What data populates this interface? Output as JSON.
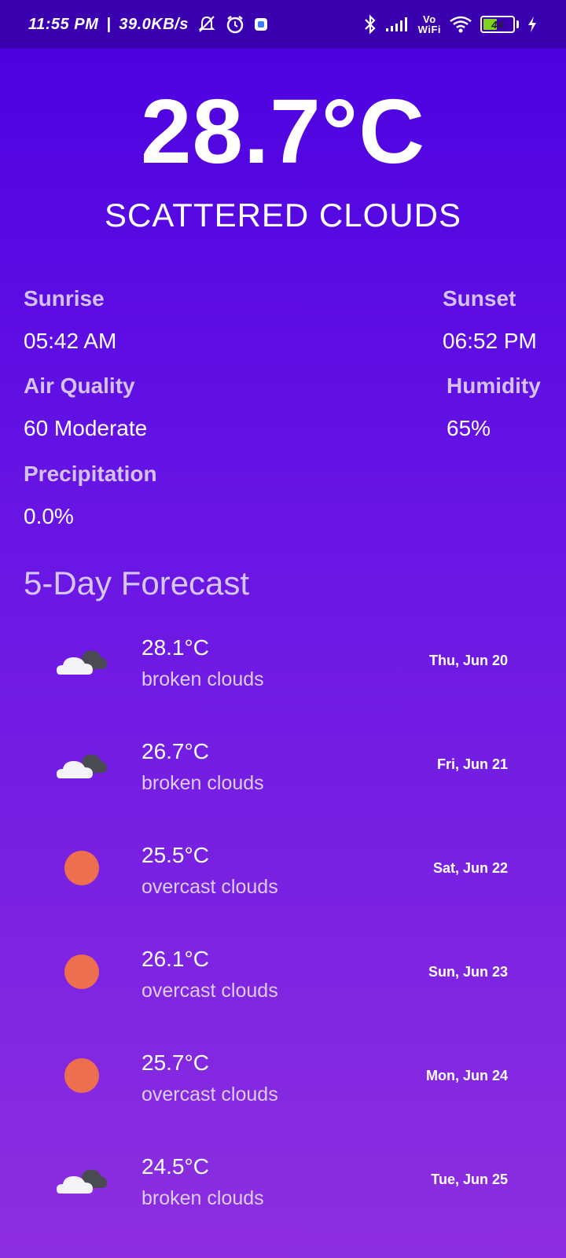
{
  "status_bar": {
    "time": "11:55 PM",
    "speed": "39.0KB/s",
    "battery": "44",
    "vowifi_top": "Vo",
    "vowifi_bottom": "WiFi"
  },
  "current": {
    "temperature": "28.7°C",
    "condition": "SCATTERED CLOUDS"
  },
  "details": {
    "sunrise_label": "Sunrise",
    "sunrise_value": "05:42 AM",
    "sunset_label": "Sunset",
    "sunset_value": "06:52 PM",
    "air_quality_label": "Air Quality",
    "air_quality_value": "60 Moderate",
    "humidity_label": "Humidity",
    "humidity_value": "65%",
    "precipitation_label": "Precipitation",
    "precipitation_value": "0.0%"
  },
  "forecast": {
    "title": "5-Day Forecast",
    "days": [
      {
        "temp": "28.1°C",
        "desc": "broken clouds",
        "date": "Thu, Jun 20",
        "icon": "cloud-icon"
      },
      {
        "temp": "26.7°C",
        "desc": "broken clouds",
        "date": "Fri, Jun 21",
        "icon": "cloud-icon"
      },
      {
        "temp": "25.5°C",
        "desc": "overcast clouds",
        "date": "Sat, Jun 22",
        "icon": "sun-icon"
      },
      {
        "temp": "26.1°C",
        "desc": "overcast clouds",
        "date": "Sun, Jun 23",
        "icon": "sun-icon"
      },
      {
        "temp": "25.7°C",
        "desc": "overcast clouds",
        "date": "Mon, Jun 24",
        "icon": "sun-icon"
      },
      {
        "temp": "24.5°C",
        "desc": "broken clouds",
        "date": "Tue, Jun 25",
        "icon": "cloud-icon"
      }
    ]
  },
  "colors": {
    "gradient_top": "#4a00e0",
    "gradient_bottom": "#8d2fe0",
    "sun": "#ee6f4f",
    "label": "#d4c2f5"
  }
}
